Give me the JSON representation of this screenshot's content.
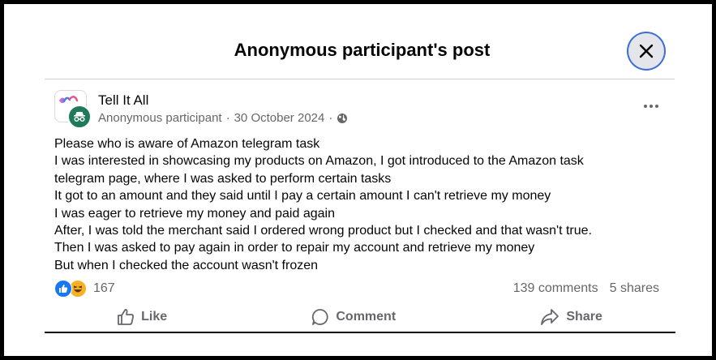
{
  "dialog": {
    "title": "Anonymous participant's post",
    "close_icon": "close-icon"
  },
  "post": {
    "group_name": "Tell It All",
    "author": "Anonymous participant",
    "separator": "·",
    "date": "30 October 2024",
    "privacy_icon": "globe-icon",
    "more_icon": "more-horizontal-icon",
    "lines": [
      "Please who is aware of Amazon telegram task",
      "I was interested in showcasing my products on Amazon, I got introduced to the Amazon task",
      "telegram page, where I was asked to perform certain tasks",
      "It got to an amount and they said until I pay a certain amount I can't retrieve my money",
      "I was eager to retrieve my money and paid again",
      "After, I was told the merchant said I ordered wrong product but I checked and that wasn't true.",
      "Then I was asked to pay again in order to repair my account and retrieve my money",
      "But when I checked the account wasn't frozen"
    ]
  },
  "engagement": {
    "reaction_count": "167",
    "comments": "139 comments",
    "shares": "5 shares"
  },
  "actions": {
    "like": "Like",
    "comment": "Comment",
    "share": "Share"
  },
  "colors": {
    "like_blue": "#1877f2",
    "haha_yellow": "#f7b125",
    "anon_green": "#1f7a5a",
    "secondary_text": "#65676b"
  }
}
